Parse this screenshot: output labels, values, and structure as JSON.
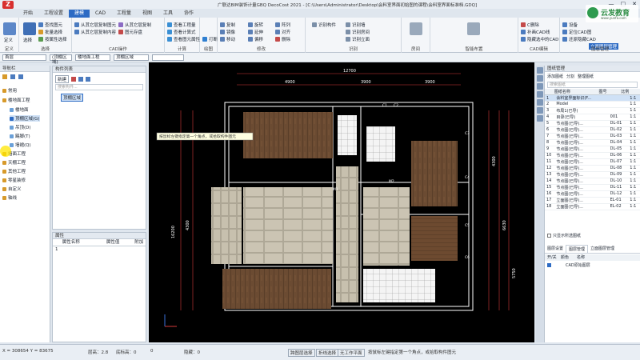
{
  "title": "广联达BIM装饰计量GBQ DecoCost 2021 - [C:\\Users\\Administrator\\Desktop\\会料室界面初始图的课程\\会料室界面标准档.GDQ]",
  "menu": [
    "开始",
    "工程设置",
    "建模",
    "CAD",
    "工程量",
    "视图",
    "工具",
    "协作"
  ],
  "menu_active_index": 2,
  "ribbon": {
    "groups": [
      {
        "label": "定义",
        "items": [
          "定义"
        ]
      },
      {
        "label": "选择",
        "items": [
          "选择",
          "查找图元",
          "批量选择",
          "按属性选择"
        ]
      },
      {
        "label": "CAD操作",
        "items": [
          "从其它层复制图元",
          "从其它层复制内容",
          "从其它层复制",
          "图元存盘"
        ]
      },
      {
        "label": "计算",
        "items": [
          "查看工程量",
          "查看计算式",
          "查看图元属性"
        ]
      },
      {
        "label": "绘图",
        "items": [
          "打断"
        ]
      },
      {
        "label": "修改",
        "items": [
          "复制",
          "镜像",
          "移动",
          "旋转",
          "延伸",
          "偏移",
          "阵列",
          "对齐",
          "删除"
        ]
      },
      {
        "label": "识别",
        "items": [
          "识别构件",
          "识别墙",
          "识别房间",
          "识别立面"
        ]
      },
      {
        "label": "房间",
        "items": [
          "房间"
        ]
      },
      {
        "label": "智能布置",
        "items": [
          "智能布置"
        ]
      },
      {
        "label": "CAD编辑",
        "items": [
          "C删除",
          "补画CAD线",
          "隐藏选中的CAD"
        ]
      },
      {
        "label": "图层管理",
        "items": [
          "设备",
          "定位CAD图",
          "还原隐藏CAD",
          "立面图层管理"
        ]
      }
    ]
  },
  "optbar": {
    "floor": "首层",
    "type": "(顶棚区域)",
    "category": "楼地面工程",
    "item": "顶棚区域"
  },
  "nav": {
    "header": "导航栏",
    "items": [
      "常用",
      "楼地面工程",
      "楼地面",
      "顶棚区域(G)",
      "吊顶(D)",
      "踢脚(T)",
      "墙裙(Q)",
      "墙面工程",
      "天棚工程",
      "其他工程",
      "零星装修",
      "自定义",
      "轴线"
    ]
  },
  "complist": {
    "header": "构件列表",
    "search": "搜索构件...",
    "new": "新建",
    "tag": "顶棚区域"
  },
  "props": {
    "header": "属性",
    "cols": [
      "属性名称",
      "属性值",
      "附加"
    ]
  },
  "canvas": {
    "tooltip": "按鼠标左键指定第一个角点，或拾取构件图元",
    "dims_top": [
      "12700",
      "4900",
      "3900",
      "3900"
    ],
    "dims_left": [
      "16200",
      "4300"
    ],
    "dims_right": [
      "4300",
      "6630",
      "5750"
    ],
    "labels": [
      "C1",
      "C2",
      "C3",
      "C4",
      "C5",
      "C6",
      "M1",
      "M2",
      "M3"
    ]
  },
  "rightpanel": {
    "header": "图纸管理",
    "toolbar": [
      "添加图纸",
      "分割",
      "整理图纸"
    ],
    "search": "搜索图纸",
    "cols": [
      "图纸名称",
      "图号",
      "比例"
    ],
    "rows": [
      {
        "n": "1",
        "name": "会料室界面标识(F...",
        "no": "",
        "ratio": "1:1"
      },
      {
        "n": "2",
        "name": "Model",
        "no": "",
        "ratio": "1:1"
      },
      {
        "n": "3",
        "name": "布局1(已导)",
        "no": "",
        "ratio": "1:1"
      },
      {
        "n": "4",
        "name": "目录(已导)",
        "no": "001",
        "ratio": "1:1"
      },
      {
        "n": "5",
        "name": "节点图(已导)...",
        "no": "DL-01",
        "ratio": "1:1"
      },
      {
        "n": "6",
        "name": "节点图(已导)...",
        "no": "DL-02",
        "ratio": "1:1"
      },
      {
        "n": "7",
        "name": "节点图(已导)...",
        "no": "DL-03",
        "ratio": "1:1"
      },
      {
        "n": "8",
        "name": "节点图(已导)...",
        "no": "DL-04",
        "ratio": "1:1"
      },
      {
        "n": "9",
        "name": "节点图(已导)...",
        "no": "DL-05",
        "ratio": "1:1"
      },
      {
        "n": "10",
        "name": "节点图(已导)...",
        "no": "DL-06",
        "ratio": "1:1"
      },
      {
        "n": "11",
        "name": "节点图(已导)...",
        "no": "DL-07",
        "ratio": "1:1"
      },
      {
        "n": "12",
        "name": "节点图(已导)...",
        "no": "DL-08",
        "ratio": "1:1"
      },
      {
        "n": "13",
        "name": "节点图(已导)...",
        "no": "DL-09",
        "ratio": "1:1"
      },
      {
        "n": "14",
        "name": "节点图(已导)...",
        "no": "DL-10",
        "ratio": "1:1"
      },
      {
        "n": "15",
        "name": "节点图(已导)...",
        "no": "DL-11",
        "ratio": "1:1"
      },
      {
        "n": "16",
        "name": "节点图(已导)...",
        "no": "DL-12",
        "ratio": "1:1"
      },
      {
        "n": "17",
        "name": "立面图(已导)...",
        "no": "EL-01",
        "ratio": "1:1"
      },
      {
        "n": "18",
        "name": "立面图(已导)...",
        "no": "EL-02",
        "ratio": "1:1"
      }
    ],
    "checkbox_label": "只显示所选图纸",
    "tabs": [
      "图层设置",
      "图层管理",
      "立面图层管理"
    ],
    "layer_cols": [
      "开/关",
      "颜色",
      "名称"
    ],
    "layer_row": "CAD原始图层"
  },
  "status": {
    "coords": "X = 308654 Y = 83675",
    "floor_height": "层高：2.8",
    "elevation": "底标高：0",
    "value": "0",
    "hidden": "隐藏：0",
    "mode1": "跨图层选择",
    "mode2": "折线选择",
    "mode3": "无工作平面",
    "hint": "按鼠标左键指定第一个角点，或拾取构件图元"
  },
  "watermark": "云发教育",
  "watermark_sub": "www.yunfa.com",
  "colors": {
    "accent": "#2d6bc4",
    "wood": "#6b4b32",
    "tile": "#c9c2b2",
    "cad_line": "#ffffff",
    "dim_line": "#d33a3a"
  }
}
